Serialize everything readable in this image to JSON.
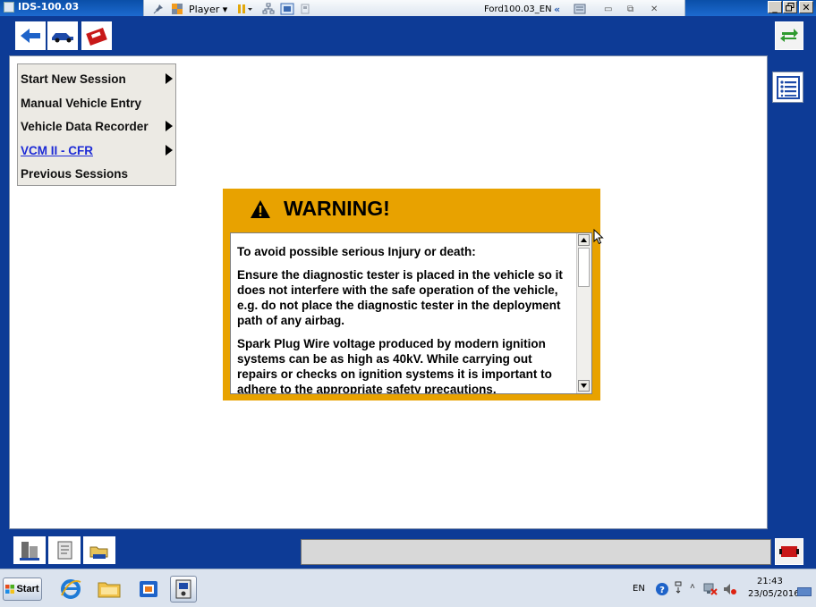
{
  "window": {
    "title": "IDS-100.03"
  },
  "player": {
    "label": "Player",
    "vm_name": "Ford100.03_EN"
  },
  "menu": {
    "items": [
      {
        "label": "Start New Session",
        "submenu": true
      },
      {
        "label": "Manual Vehicle Entry",
        "submenu": false
      },
      {
        "label": "Vehicle Data Recorder",
        "submenu": true
      },
      {
        "label": "VCM II - CFR",
        "submenu": true,
        "link": true
      },
      {
        "label": "Previous Sessions",
        "submenu": false
      }
    ]
  },
  "warning": {
    "title": "WARNING!",
    "paragraphs": [
      "To avoid possible serious Injury or death:",
      "Ensure the diagnostic tester is placed in the vehicle so it does not interfere with the safe operation of the vehicle, e.g. do not place the diagnostic tester in the deployment path of any airbag.",
      "Spark Plug Wire voltage produced by modern ignition systems can be as high as 40kV. While carrying out repairs or checks on ignition systems it is important to adhere to the appropriate safety precautions."
    ]
  },
  "taskbar": {
    "start_label": "Start",
    "language": "EN",
    "time": "21:43",
    "date": "23/05/2016"
  },
  "colors": {
    "app_blue": "#0d3b96",
    "warning_orange": "#e8a200",
    "link_blue": "#1d2bd6"
  }
}
